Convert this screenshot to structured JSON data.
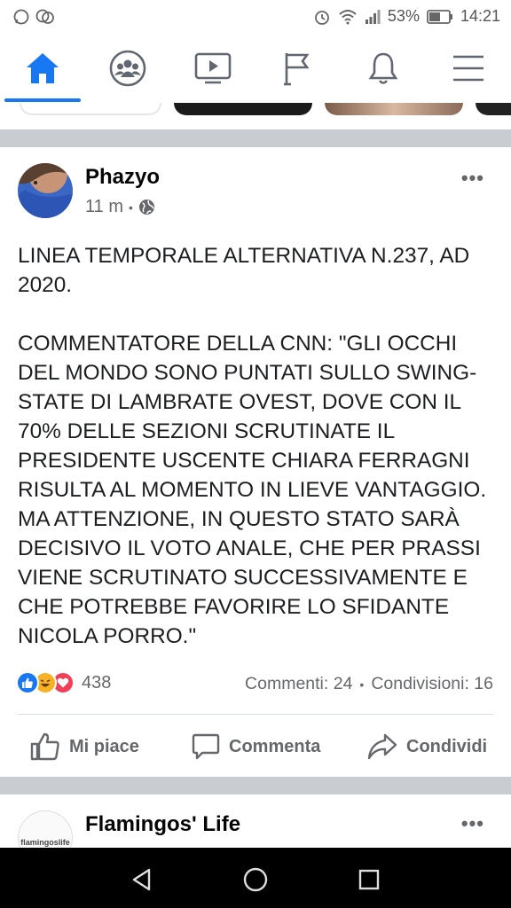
{
  "status_bar": {
    "battery": "53%",
    "time": "14:21",
    "icons": [
      "whatsapp-icon",
      "messenger-icon",
      "alarm-icon",
      "wifi-icon",
      "signal-icon",
      "battery-icon"
    ]
  },
  "nav": {
    "items": [
      "home-icon",
      "groups-icon",
      "watch-icon",
      "pages-icon",
      "notifications-icon",
      "menu-icon"
    ],
    "active_color": "#1877f2",
    "inactive_color": "#606770"
  },
  "post": {
    "author": "Phazyo",
    "time": "11 m",
    "separator": "•",
    "more": "•••",
    "text": "LINEA TEMPORALE ALTERNATIVA N.237, AD 2020.\n\nCOMMENTATORE DELLA CNN: \"GLI OCCHI DEL MONDO SONO PUNTATI SULLO SWING-STATE DI LAMBRATE OVEST, DOVE CON IL 70% DELLE SEZIONI SCRUTINATE IL PRESIDENTE USCENTE CHIARA FERRAGNI RISULTA AL MOMENTO IN LIEVE VANTAGGIO. MA ATTENZIONE, IN QUESTO STATO SARÀ DECISIVO IL VOTO ANALE, CHE PER PRASSI VIENE SCRUTINATO SUCCESSIVAMENTE E CHE POTREBBE FAVORIRE LO SFIDANTE NICOLA PORRO.\"",
    "reactions_count": "438",
    "comments": "Commenti: 24",
    "shares": "Condivisioni: 16",
    "stats_separator": "•",
    "actions": {
      "like": "Mi piace",
      "comment": "Commenta",
      "share": "Condividi"
    }
  },
  "next_post": {
    "author": "Flamingos' Life",
    "avatar_text": "flamingoslife",
    "more": "•••"
  }
}
